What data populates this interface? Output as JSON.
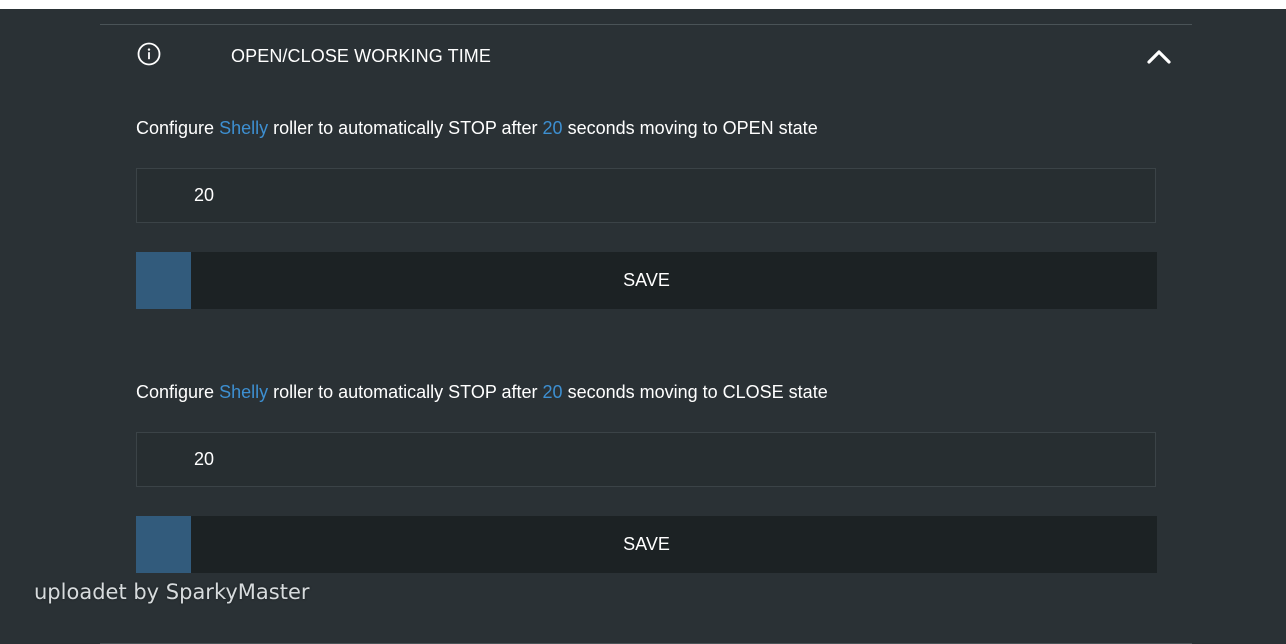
{
  "section": {
    "title": "OPEN/CLOSE WORKING TIME",
    "info_icon": "info-circle-icon",
    "toggle_icon": "chevron-up-icon"
  },
  "open_config": {
    "desc_prefix": "Configure ",
    "device": "Shelly",
    "desc_mid": " roller to automatically STOP after ",
    "seconds": "20",
    "desc_suffix": " seconds moving to OPEN state",
    "input_value": "20",
    "save_label": "SAVE",
    "save_progress_percent": 5
  },
  "close_config": {
    "desc_prefix": "Configure ",
    "device": "Shelly",
    "desc_mid": " roller to automatically STOP after ",
    "seconds": "20",
    "desc_suffix": " seconds moving to CLOSE state",
    "input_value": "20",
    "save_label": "SAVE",
    "save_progress_percent": 5
  },
  "watermark": "uploadet by SparkyMaster",
  "colors": {
    "background": "#2a3135",
    "accent": "#3d8fd1",
    "button_bg": "#1c2224",
    "button_progress": "#325b7c",
    "text": "#ffffff"
  }
}
